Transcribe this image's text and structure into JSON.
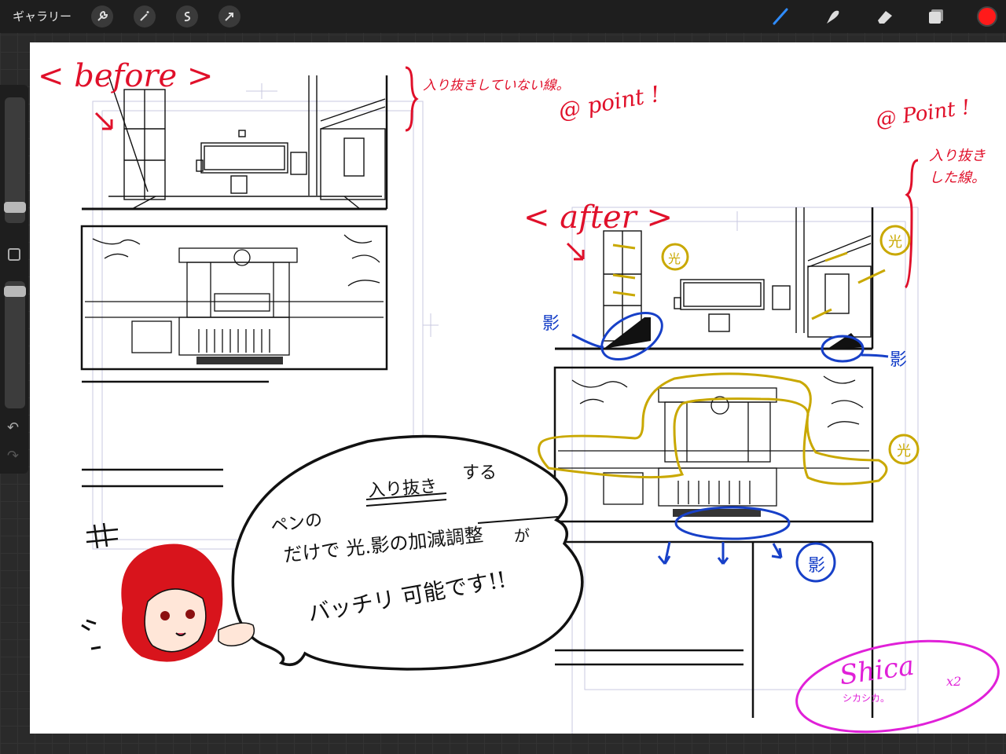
{
  "toolbar": {
    "gallery_label": "ギャラリー",
    "left_tools": [
      "wrench-icon",
      "magic-wand-icon",
      "selection-icon",
      "transform-arrow-icon"
    ],
    "right_tools": [
      "brush-icon",
      "smudge-icon",
      "eraser-icon",
      "layers-icon"
    ],
    "current_color": "#ff1a1a"
  },
  "sidebar": {
    "undo_icon": "undo-icon",
    "redo_icon": "redo-icon"
  },
  "canvas": {
    "before_label": "< before >",
    "before_note": "入り抜きしていない線。",
    "point_note_1": "@ point !",
    "point_note_2": "@ Point !",
    "after_label": "< after >",
    "after_note_1": "入り抜き",
    "after_note_2": "した線。",
    "light_label": "光",
    "shadow_label": "影",
    "bubble_line1_a": "ペンの",
    "bubble_line1_b": "入り抜き",
    "bubble_line1_c": "する",
    "bubble_line2": "だけで 光.影の加減調整",
    "bubble_line2_ga": "が",
    "bubble_line3": "バッチリ 可能です!!",
    "hash_mark": "#",
    "signature": "Shica",
    "signature_sub": "シカシカ。",
    "signature_x2": "x2"
  },
  "colors": {
    "annotation_red": "#e0102a",
    "annotation_blue": "#1740c8",
    "annotation_yellow": "#c9a800",
    "signature_magenta": "#e020d8"
  }
}
